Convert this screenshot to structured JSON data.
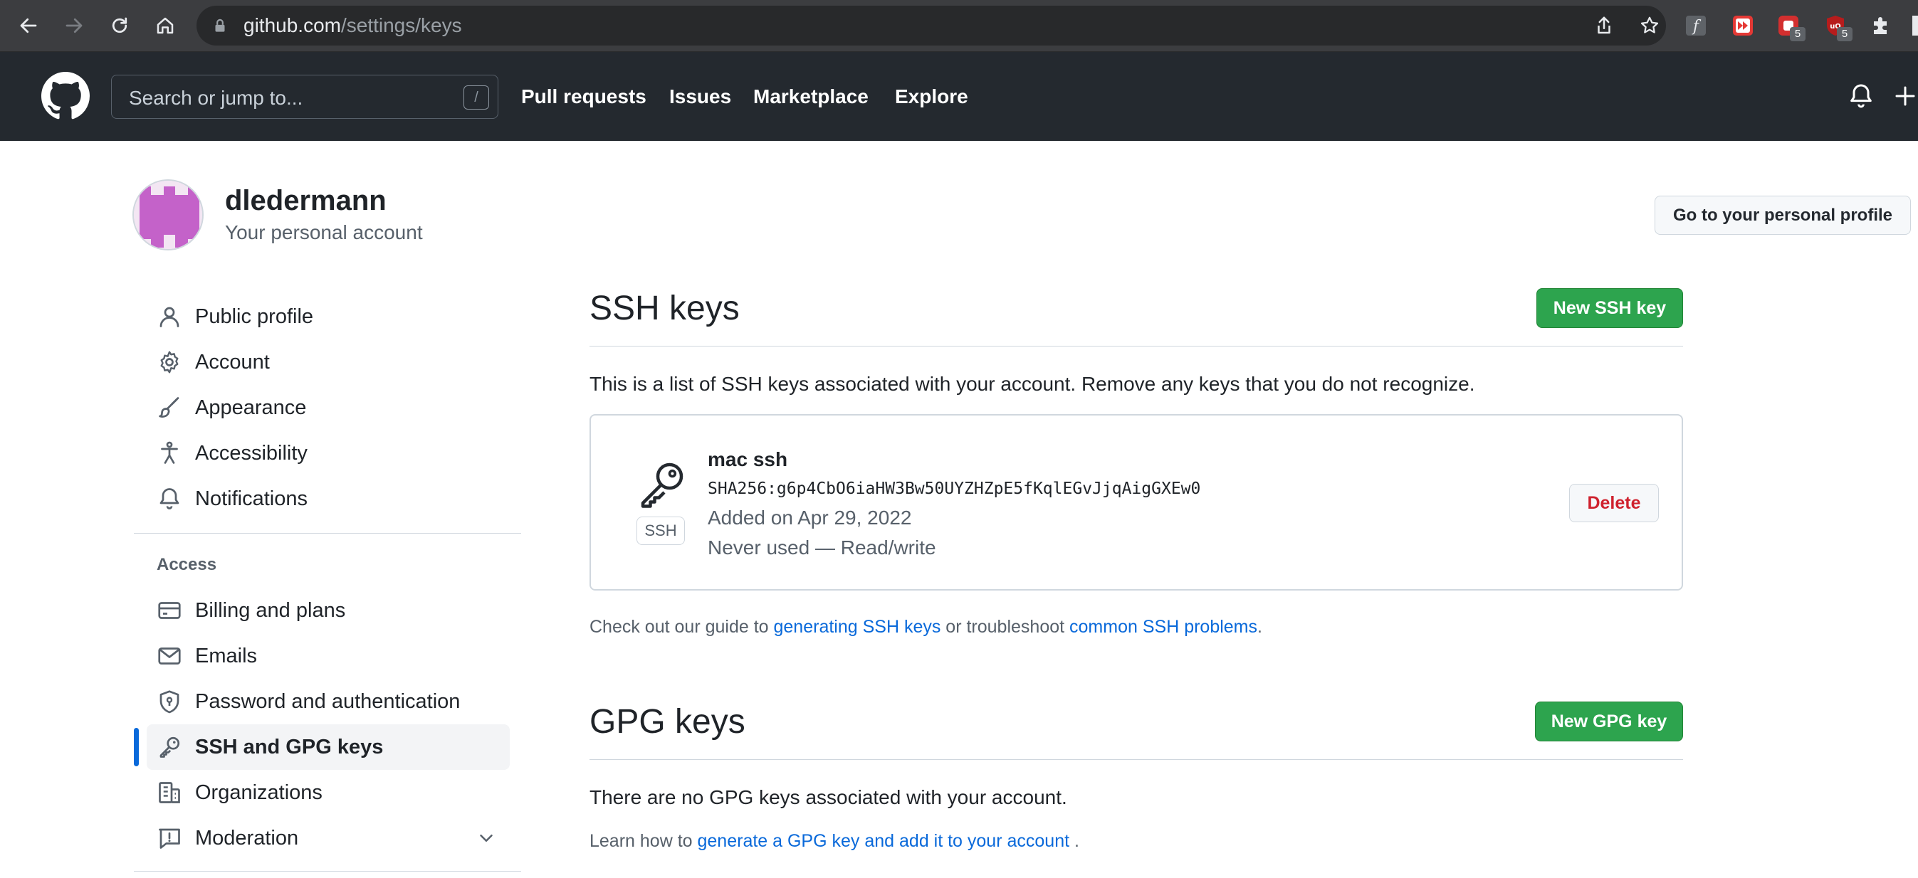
{
  "browser": {
    "url_host": "github.com",
    "url_path": "/settings/keys",
    "extensions": [
      {
        "icon": "script-f-icon"
      },
      {
        "icon": "media-forward-icon"
      },
      {
        "icon": "red-square-icon",
        "badge": "5"
      },
      {
        "icon": "ublock-icon",
        "badge": "5"
      },
      {
        "icon": "puzzle-icon"
      }
    ]
  },
  "header": {
    "search_placeholder": "Search or jump to...",
    "search_shortcut": "/",
    "nav": [
      "Pull requests",
      "Issues",
      "Marketplace",
      "Explore"
    ]
  },
  "account": {
    "username": "dledermann",
    "subtitle": "Your personal account",
    "profile_button": "Go to your personal profile"
  },
  "sidebar": {
    "items": [
      {
        "label": "Public profile",
        "icon": "person-icon"
      },
      {
        "label": "Account",
        "icon": "gear-icon"
      },
      {
        "label": "Appearance",
        "icon": "paintbrush-icon"
      },
      {
        "label": "Accessibility",
        "icon": "accessibility-icon"
      },
      {
        "label": "Notifications",
        "icon": "bell-icon"
      }
    ],
    "access_heading": "Access",
    "access_items": [
      {
        "label": "Billing and plans",
        "icon": "credit-card-icon"
      },
      {
        "label": "Emails",
        "icon": "mail-icon"
      },
      {
        "label": "Password and authentication",
        "icon": "shield-lock-icon"
      },
      {
        "label": "SSH and GPG keys",
        "icon": "key-icon",
        "active": true
      },
      {
        "label": "Organizations",
        "icon": "organization-icon"
      },
      {
        "label": "Moderation",
        "icon": "report-icon"
      }
    ]
  },
  "ssh": {
    "title": "SSH keys",
    "new_button": "New SSH key",
    "description": "This is a list of SSH keys associated with your account. Remove any keys that you do not recognize.",
    "key": {
      "type_label": "SSH",
      "name": "mac ssh",
      "fingerprint": "SHA256:g6p4CbO6iaHW3Bw50UYZHZpE5fKqlEGvJjqAigGXEw0",
      "added": "Added on Apr 29, 2022",
      "usage": "Never used — Read/write",
      "delete_button": "Delete"
    },
    "guide_prefix": "Check out our guide to ",
    "guide_link1": "generating SSH keys",
    "guide_middle": " or troubleshoot ",
    "guide_link2": "common SSH problems",
    "guide_suffix": "."
  },
  "gpg": {
    "title": "GPG keys",
    "new_button": "New GPG key",
    "empty_text": "There are no GPG keys associated with your account.",
    "learn_prefix": "Learn how to ",
    "learn_link": "generate a GPG key and add it to your account",
    "learn_suffix": " ."
  },
  "colors": {
    "header_bg": "#24292f",
    "primary_green": "#2da44e",
    "link_blue": "#0969da",
    "danger_red": "#cf222e",
    "active_indicator": "#0969da"
  }
}
